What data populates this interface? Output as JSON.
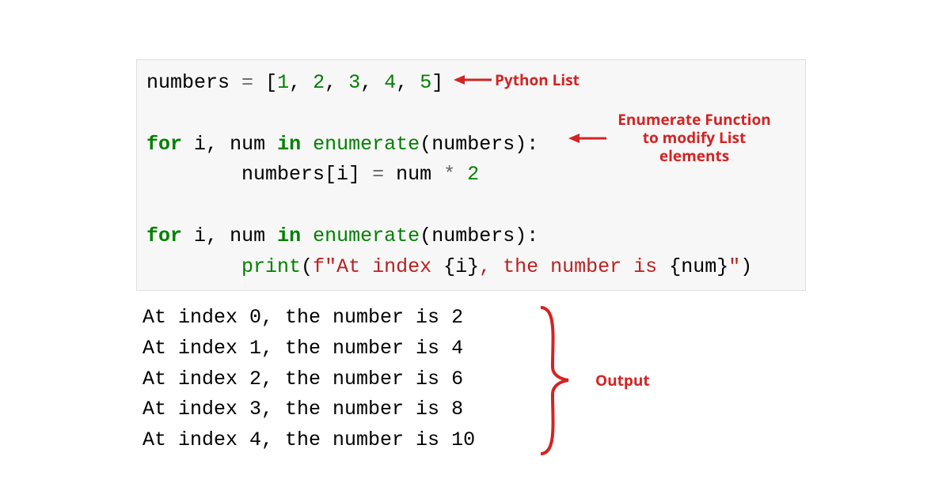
{
  "code": {
    "line1": {
      "var": "numbers",
      "eq": "=",
      "lb": "[",
      "n1": "1",
      "c1": ",",
      "n2": "2",
      "c2": ",",
      "n3": "3",
      "c3": ",",
      "n4": "4",
      "c4": ",",
      "n5": "5",
      "rb": "]"
    },
    "line3": {
      "for": "for",
      "i": "i",
      "c": ",",
      "num": "num",
      "in": "in",
      "enum": "enumerate",
      "lp": "(",
      "arg": "numbers",
      "rp": "):"
    },
    "line4": {
      "indent": "        ",
      "lhs": "numbers[i]",
      "eq": "=",
      "rhs1": "num",
      "star": "*",
      "two": "2"
    },
    "line6": {
      "for": "for",
      "i": "i",
      "c": ",",
      "num": "num",
      "in": "in",
      "enum": "enumerate",
      "lp": "(",
      "arg": "numbers",
      "rp": "):"
    },
    "line7": {
      "indent": "        ",
      "print": "print",
      "lp": "(",
      "f": "f\"At index ",
      "lb1": "{",
      "i": "i",
      "rb1": "}",
      "mid": ", the number is ",
      "lb2": "{",
      "num": "num",
      "rb2": "}",
      "end": "\"",
      "rp": ")"
    }
  },
  "output": {
    "l1": "At index 0, the number is 2",
    "l2": "At index 1, the number is 4",
    "l3": "At index 2, the number is 6",
    "l4": "At index 3, the number is 8",
    "l5": "At index 4, the number is 10"
  },
  "annotations": {
    "pythonList": "Python List",
    "enumerate_l1": "Enumerate Function",
    "enumerate_l2": "to modify List",
    "enumerate_l3": "elements",
    "output": "Output"
  },
  "colors": {
    "annotation": "#d32323"
  }
}
